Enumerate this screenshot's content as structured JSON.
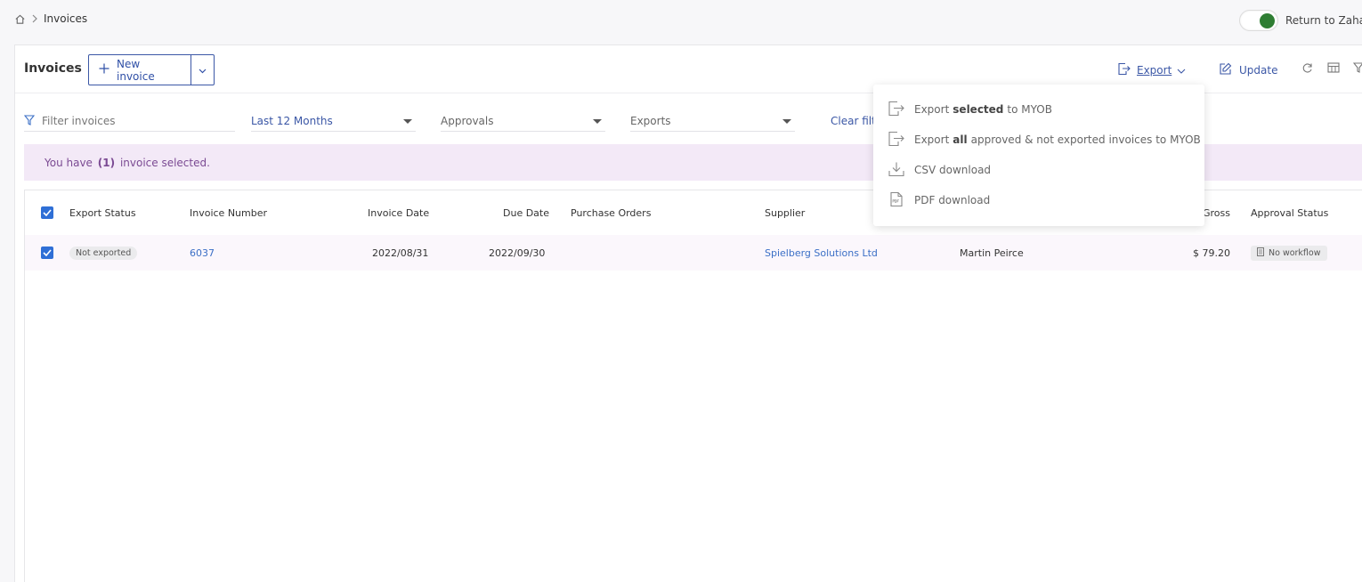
{
  "breadcrumb": {
    "home_icon": "home-icon",
    "current": "Invoices"
  },
  "return_toggle": {
    "label": "Return to Zahar",
    "on": true,
    "color": "#2e7d32"
  },
  "header": {
    "title": "Invoices",
    "new_invoice_label": "New invoice",
    "export_label": "Export",
    "update_label": "Update"
  },
  "filters": {
    "search_placeholder": "Filter invoices",
    "period": "Last 12 Months",
    "approvals": "Approvals",
    "exports": "Exports",
    "clear_label": "Clear filt"
  },
  "selection": {
    "prefix": "You have",
    "count": "(1)",
    "suffix": "invoice selected."
  },
  "table": {
    "columns": [
      "Export Status",
      "Invoice Number",
      "Invoice Date",
      "Due Date",
      "Purchase Orders",
      "Supplier",
      "Gross",
      "Approval Status"
    ],
    "rows": [
      {
        "export_status": "Not exported",
        "invoice_number": "6037",
        "invoice_date": "2022/08/31",
        "due_date": "2022/09/30",
        "purchase_orders": "",
        "supplier": "Spielberg Solutions Ltd",
        "person": "Martin Peirce",
        "gross": "$ 79.20",
        "approval_status": "No workflow"
      }
    ]
  },
  "export_menu": {
    "items": [
      {
        "pre": "Export",
        "bold": "selected",
        "post": "to MYOB",
        "icon": "export-file-icon"
      },
      {
        "pre": "Export",
        "bold": "all",
        "post": "approved & not exported invoices to MYOB",
        "icon": "export-file-icon"
      },
      {
        "pre": "CSV download",
        "bold": "",
        "post": "",
        "icon": "download-icon"
      },
      {
        "pre": "PDF download",
        "bold": "",
        "post": "",
        "icon": "pdf-icon"
      }
    ]
  },
  "colors": {
    "accent": "#3b57a6",
    "link": "#3b6fc6",
    "selection_bg": "#f3e9f7",
    "checkbox": "#2f6fd6"
  }
}
